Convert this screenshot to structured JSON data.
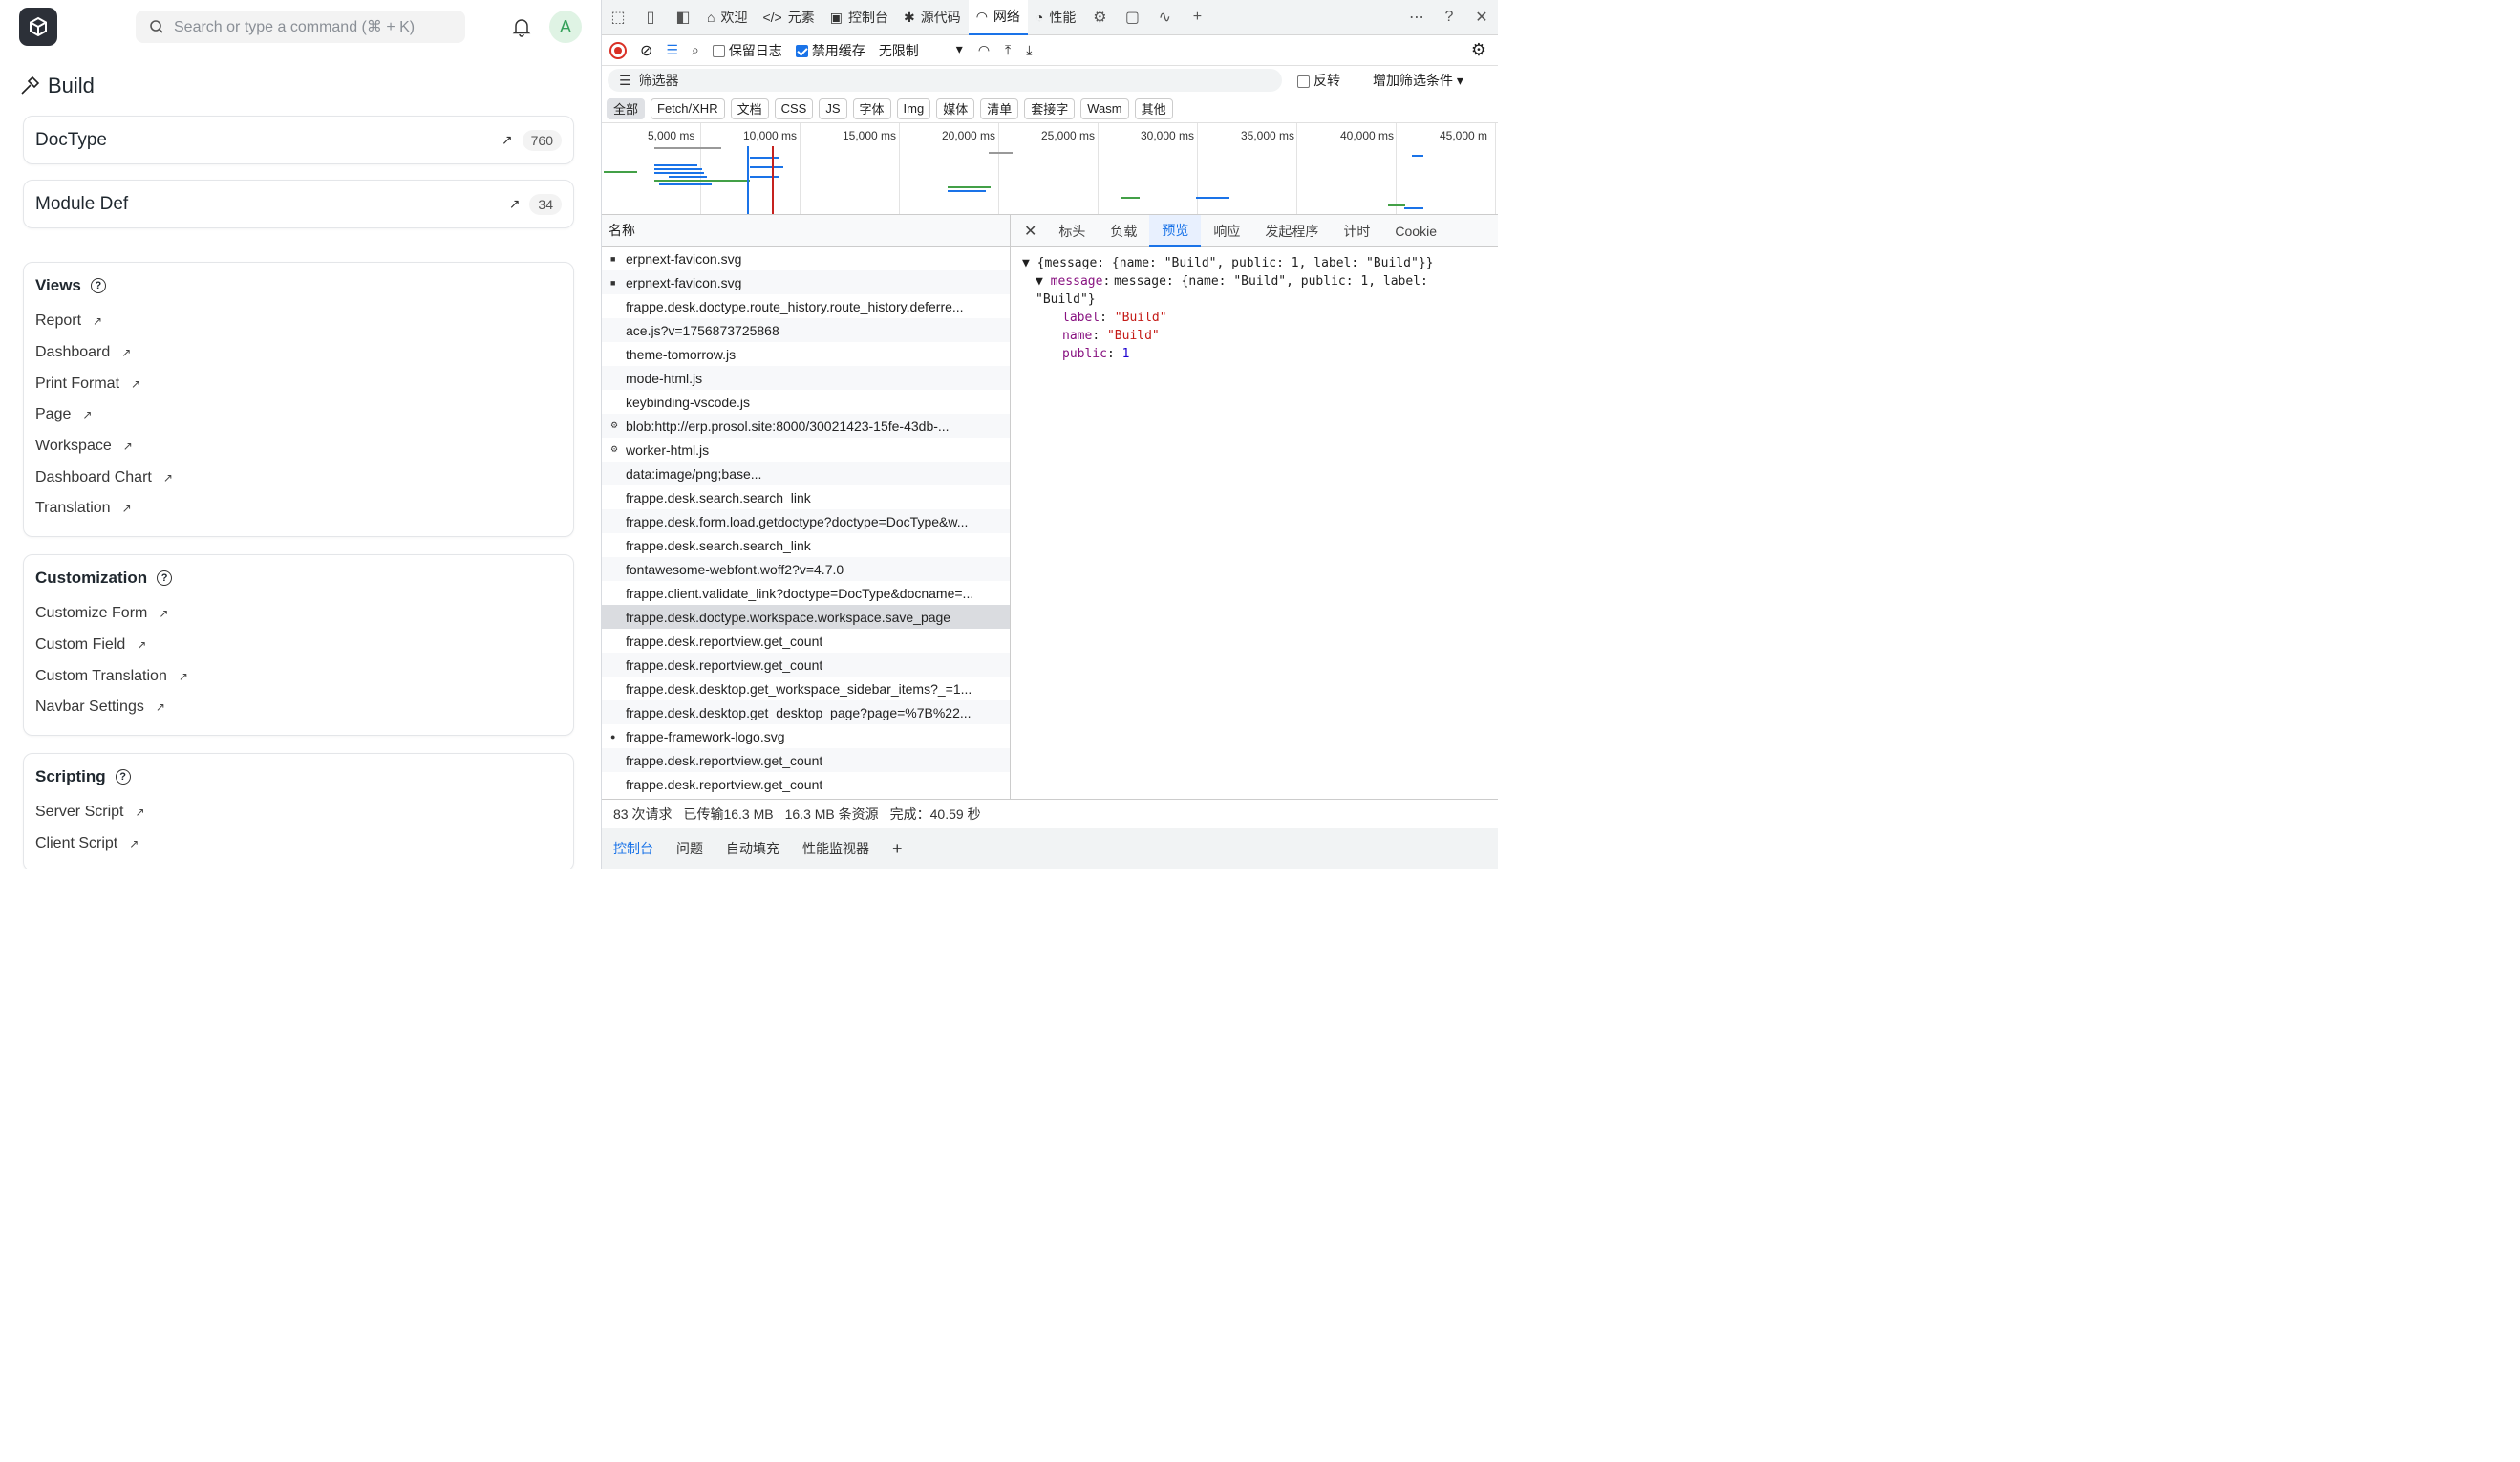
{
  "app": {
    "search_placeholder": "Search or type a command (⌘ + K)",
    "avatar": "A",
    "page_title": "Build"
  },
  "cards": [
    {
      "label": "DocType",
      "count": "760"
    },
    {
      "label": "Module Def",
      "count": "34"
    }
  ],
  "sections": [
    {
      "title": "Views",
      "links": [
        "Report",
        "Dashboard",
        "Print Format",
        "Page",
        "Workspace",
        "Dashboard Chart",
        "Translation"
      ]
    },
    {
      "title": "Customization",
      "links": [
        "Customize Form",
        "Custom Field",
        "Custom Translation",
        "Navbar Settings"
      ]
    },
    {
      "title": "Scripting",
      "links": [
        "Server Script",
        "Client Script"
      ]
    }
  ],
  "devtools": {
    "tabs": [
      "欢迎",
      "元素",
      "控制台",
      "源代码",
      "网络",
      "性能"
    ],
    "active_tab": "网络",
    "toolbar": {
      "preserve_log": "保留日志",
      "disable_cache": "禁用缓存",
      "throttle": "无限制"
    },
    "filter": {
      "placeholder": "筛选器",
      "invert": "反转",
      "more": "增加筛选条件"
    },
    "types": [
      "全部",
      "Fetch/XHR",
      "文档",
      "CSS",
      "JS",
      "字体",
      "Img",
      "媒体",
      "清单",
      "套接字",
      "Wasm",
      "其他"
    ],
    "ticks": [
      "5,000 ms",
      "10,000 ms",
      "15,000 ms",
      "20,000 ms",
      "25,000 ms",
      "30,000 ms",
      "35,000 ms",
      "40,000 ms",
      "45,000 m"
    ],
    "name_header": "名称",
    "detail_tabs": [
      "标头",
      "负载",
      "预览",
      "响应",
      "发起程序",
      "计时",
      "Cookie"
    ],
    "active_detail": "预览",
    "requests": [
      "erpnext-favicon.svg",
      "erpnext-favicon.svg",
      "frappe.desk.doctype.route_history.route_history.deferre...",
      "ace.js?v=1756873725868",
      "theme-tomorrow.js",
      "mode-html.js",
      "keybinding-vscode.js",
      "blob:http://erp.prosol.site:8000/30021423-15fe-43db-...",
      "worker-html.js",
      "data:image/png;base...",
      "frappe.desk.search.search_link",
      "frappe.desk.form.load.getdoctype?doctype=DocType&w...",
      "frappe.desk.search.search_link",
      "fontawesome-webfont.woff2?v=4.7.0",
      "frappe.client.validate_link?doctype=DocType&docname=...",
      "frappe.desk.doctype.workspace.workspace.save_page",
      "frappe.desk.reportview.get_count",
      "frappe.desk.reportview.get_count",
      "frappe.desk.desktop.get_workspace_sidebar_items?_=1...",
      "frappe.desk.desktop.get_desktop_page?page=%7B%22...",
      "frappe-framework-logo.svg",
      "frappe.desk.reportview.get_count",
      "frappe.desk.reportview.get_count"
    ],
    "preview": {
      "line1": "{message: {name: \"Build\", public: 1, label: \"Build\"}}",
      "line2": "message: {name: \"Build\", public: 1, label: \"Build\"}",
      "label": "\"Build\"",
      "name": "\"Build\"",
      "public": "1"
    },
    "status": {
      "requests": "83 次请求",
      "transferred": "已传输16.3 MB",
      "resources": "16.3 MB 条资源",
      "finish": "完成：40.59 秒"
    },
    "drawer": [
      "控制台",
      "问题",
      "自动填充",
      "性能监视器"
    ]
  }
}
